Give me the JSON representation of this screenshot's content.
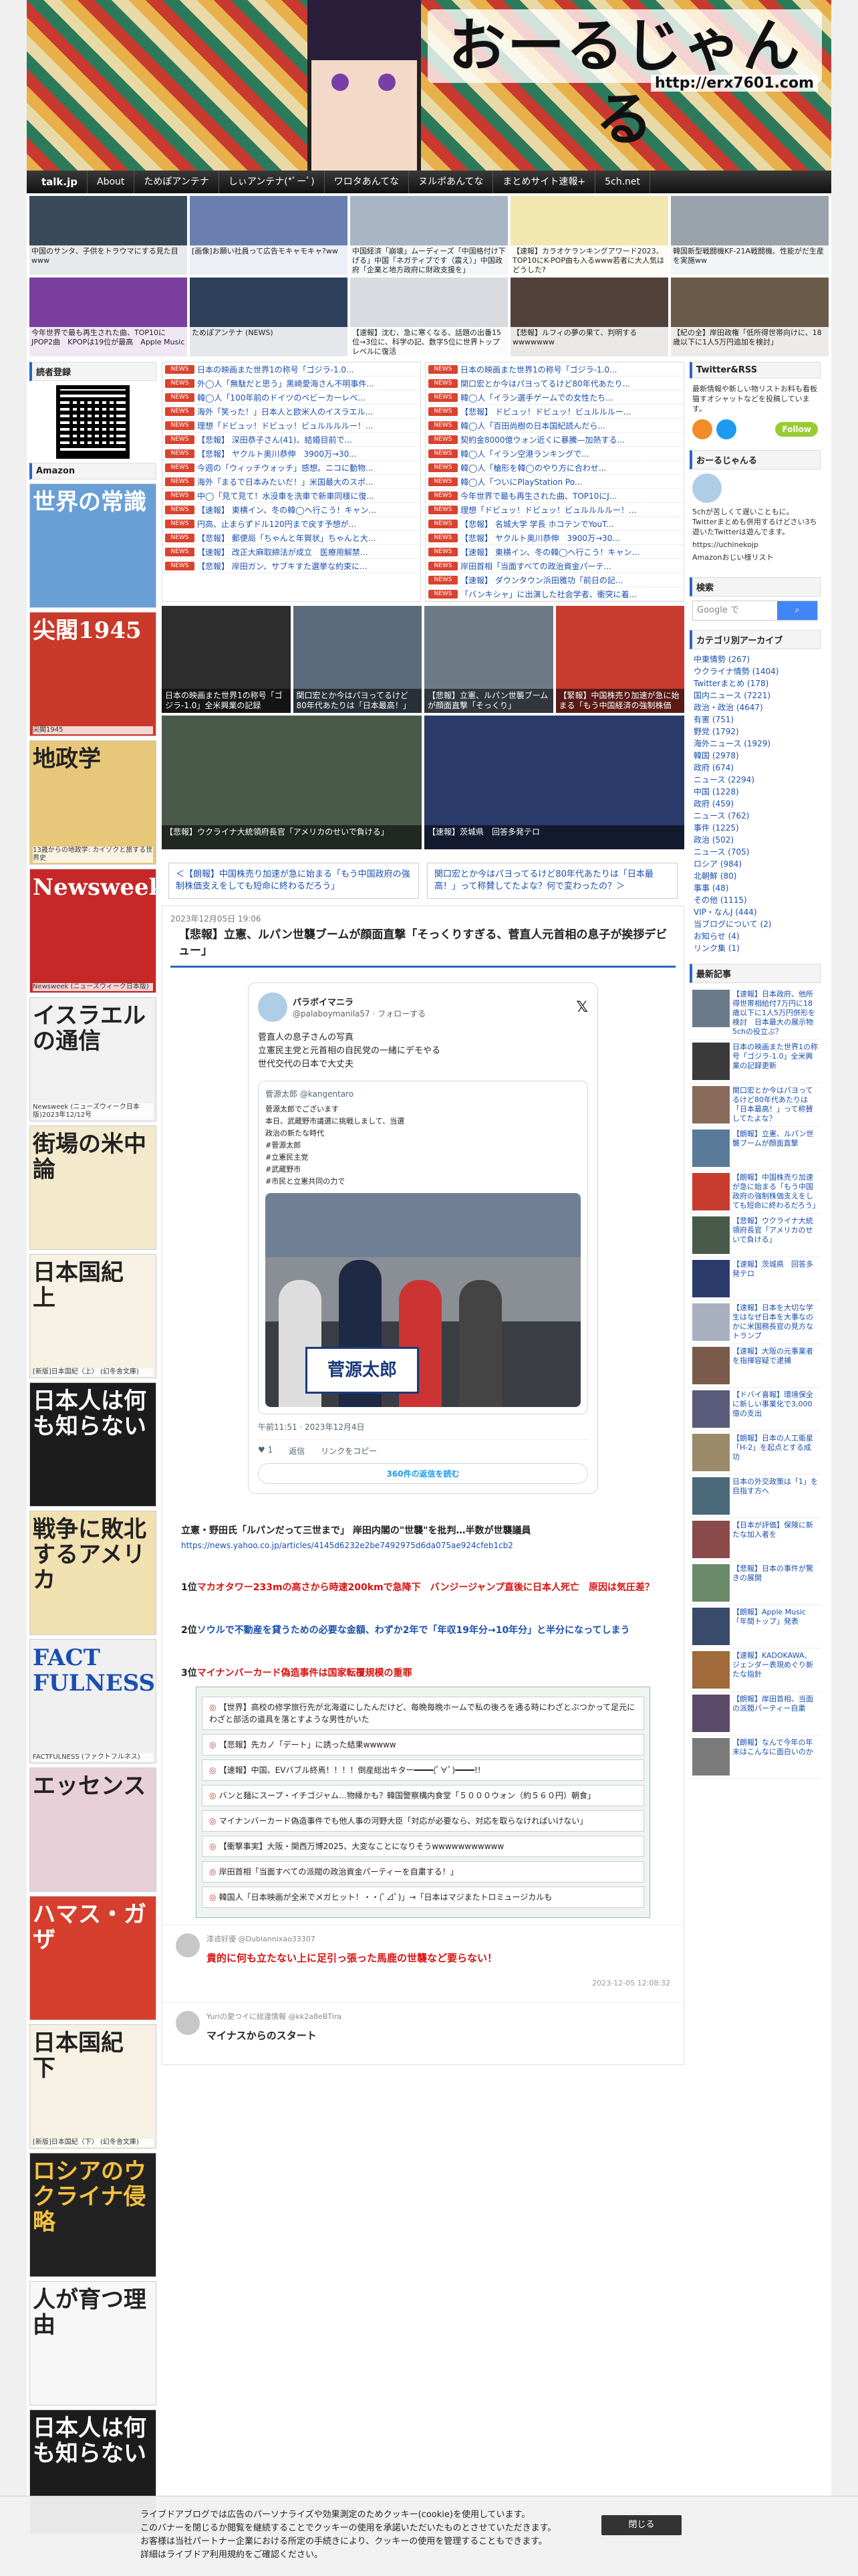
{
  "site": {
    "title": "おーるじゃんる",
    "url": "http://erx7601.com"
  },
  "nav": [
    "talk.jp",
    "About",
    "ためぽアンテナ",
    "しぃアンテナ(*ﾟーﾟ)",
    "ワロタあんてな",
    "ヌルポあんてな",
    "まとめサイト速報+",
    "5ch.net"
  ],
  "thumbs": [
    {
      "cap": "中国のサンタ、子供をトラウマにする見た目www",
      "color": "#3a4a5a"
    },
    {
      "cap": "[画像]お願い社員って広告モキャモキャ?ww",
      "color": "#6a7fb0"
    },
    {
      "cap": "中国経済「崩壊」ムーディーズ「中国格付け下げる」中国「ネガティブです（震え）」中国政府「企業と地方政府に財政支援を」",
      "color": "#a8b5c4"
    },
    {
      "cap": "【速報】カラオケランキングアワード2023、TOP10にK-POP曲も入るwww若者に大人気はどうした?",
      "color": "#f3e7b0"
    },
    {
      "cap": "韓国新型戦闘機KF-21A戦闘機、性能がだ生産を実施ww",
      "color": "#9aa2ab"
    },
    {
      "cap": "今年世界で最も再生された曲、TOP10にJPOP2曲　KPOPは19位が最高　Apple Music",
      "color": "#7a3f9f"
    },
    {
      "cap": "ためぽアンテナ (NEWS)",
      "color": "#2e3f5c"
    },
    {
      "cap": "【速報】沈む、急に寒くなる、話題の出番15位→3位に、科学の記、数字5位に世界トップレベルに復活",
      "color": "#d8dce0"
    },
    {
      "cap": "【悲報】ルフィの夢の果て、判明するwwwwwww",
      "color": "#52413a"
    },
    {
      "cap": "【紀の全】岸田政権「低所得世帯向けに、18歳以下に1人5万円追加を検討」",
      "color": "#6a5a4a"
    }
  ],
  "left": {
    "reader_head": "読者登録",
    "qr_note": "",
    "amazon_head": "Amazon",
    "books": [
      {
        "t": "世界の常識",
        "c": "",
        "bg": "#6a9fd6",
        "fg": "#fff"
      },
      {
        "t": "尖閣1945",
        "c": "尖閣1945",
        "bg": "#c93a2a",
        "fg": "#fff"
      },
      {
        "t": "地政学",
        "c": "13歳からの地政学: カイゾクと旅する世界史",
        "bg": "#e7c77a",
        "fg": "#222"
      },
      {
        "t": "Newsweek",
        "c": "Newsweek (ニューズウィーク日本版)",
        "bg": "#c62828",
        "fg": "#fff"
      },
      {
        "t": "イスラエルの通信",
        "c": "Newsweek (ニューズウィーク日本版)2023年12/12号",
        "bg": "#f1f1f1",
        "fg": "#222"
      },
      {
        "t": "街場の米中論",
        "c": "",
        "bg": "#f3e9cc",
        "fg": "#222"
      },
      {
        "t": "日本国紀 上",
        "c": "[新版]日本国紀〈上〉 (幻冬舎文庫)",
        "bg": "#f7f1e4",
        "fg": "#222"
      },
      {
        "t": "日本人は何も知らない",
        "c": "",
        "bg": "#1c1c1c",
        "fg": "#fff"
      },
      {
        "t": "戦争に敗北するアメリカ",
        "c": "",
        "bg": "#f1e0b0",
        "fg": "#222"
      },
      {
        "t": "FACT FULNESS",
        "c": "FACTFULNESS (ファクトフルネス)",
        "bg": "#f0f0f0",
        "fg": "#1a4fb0"
      },
      {
        "t": "エッセンス",
        "c": "",
        "bg": "#e8d0d8",
        "fg": "#222"
      },
      {
        "t": "ハマス・ガザ",
        "c": "",
        "bg": "#d63f2d",
        "fg": "#fff"
      },
      {
        "t": "日本国紀 下",
        "c": "[新版]日本国紀〈下〉 (幻冬舎文庫)",
        "bg": "#f7f1e4",
        "fg": "#222"
      },
      {
        "t": "ロシアのウクライナ侵略",
        "c": "",
        "bg": "#222",
        "fg": "#f5c140"
      },
      {
        "t": "人が育つ理由",
        "c": "",
        "bg": "#f7f7f7",
        "fg": "#222"
      },
      {
        "t": "日本人は何も知らない",
        "c": "",
        "bg": "#1c1c1c",
        "fg": "#fff"
      }
    ]
  },
  "lists": {
    "left": [
      "日本の映画また世界1の称号「ゴジラ-1.0...",
      "外◯人「無駄だと思う」黒崎愛海さん不明事件...",
      "韓◯人「100年前のドイツのベビーカーレベ...",
      "海外「笑った！」日本人と欧米人のイスラエル...",
      "理想「ドビュッ！ドビュッ！ビュルルルルー！...",
      "【悲報】 深田恭子さん(41)、結婚目前で...",
      "【悲報】 ヤクルト奥川恭伸　3900万→30...",
      "今週の「ウィッチウォッチ」感想。ニコに動物...",
      "海外「まるで日本みたいだ！」米国最大のスポ...",
      "中◯「見て見て！水没車を洗車で新車同様に復...",
      "【速報】 東横イン、冬の韓◯へ行こう！キャン...",
      "円高、止まらずドル120円まで戻す予想が...",
      "【悲報】 郵便局「ちゃんと年賀状」ちゃんと大...",
      "【速報】 改正大麻取締法が成立　医療用解禁...",
      "【悲報】 岸田ガン、サブキすた選挙な約束に..."
    ],
    "right": [
      "日本の映画また世界1の称号「ゴジラ-1.0...",
      "関口宏とか今はパヨってるけど80年代あたり...",
      "韓◯人「イラン選手ゲームでの女性たち...",
      "【悲報】 ドビュッ！ドビュッ！ビュルルルー...",
      "韓◯人「百田尚樹の日本国紀読んだら...",
      "契約金8000億ウォン近くに暴騰—加熱する...",
      "韓◯人「イラン空港ランキングで...",
      "韓◯人「槍形を韓◯のやり方に合わせ...",
      "韓◯人「ついにPlayStation Po...",
      "今年世界で最も再生された曲、TOP10にJ...",
      "理想「ドビュッ！ドビュッ！ビュルルルルー！...",
      "【悲報】 名城大学 学長 ホコテンでYouT...",
      "【悲報】 ヤクルト奥川恭伸　3900万→30...",
      "【速報】 東横イン、冬の韓◯へ行こう！キャン...",
      "岸田首相「当面すべての政治資金パーテ...",
      "【速報】 ダウンタウン浜田雅功「前日の記...",
      "「バンキシャ」に出演した社会学者、衝突に着..."
    ],
    "badge": "NEWS"
  },
  "featured": [
    {
      "cap": "日本の映画また世界1の称号「ゴジラ-1.0」全米興業の記録",
      "bg": "#2d2d2d"
    },
    {
      "cap": "関口宏とか今はパヨってるけど80年代あたりは「日本最高！」",
      "bg": "#5a6a7a"
    },
    {
      "cap": "【悲報】立憲、ルパン世襲ブームが顔面直撃「そっくり」",
      "bg": "#6e7b86"
    },
    {
      "cap": "【緊報】中国株売り加速が急に始まる「もう中国経済の強制株価",
      "bg": "#c83b2e"
    }
  ],
  "featured2": [
    {
      "cap": "【悲報】ウクライナ大統領府長官「アメリカのせいで負ける」",
      "bg": "#4a5a4a"
    },
    {
      "cap": "【速報】茨城県　回答多発テロ",
      "bg": "#2a3a6a"
    }
  ],
  "prevnext": {
    "prev": "＜【朗報】中国株売り加速が急に始まる「もう中国政府の強制株価支えをしても短命に終わるだろう」",
    "next": "関口宏とか今はパヨってるけど80年代あたりは「日本最高！」って称賛してたよな？何で変わったの？＞"
  },
  "article": {
    "date": "2023年12月05日 19:06",
    "title": "【悲報】立憲、ルパン世襲ブームが顔面直撃「そっくりすぎる、菅直人元首相の息子が挨拶デビュー」",
    "tweet": {
      "name": "パラボイマニラ",
      "handle": "@palaboymanila57 · フォローする",
      "body1": "菅直人の息子さんの写真",
      "body2": "立憲民主党と元首相の自民党の一緒にデモやる",
      "body3": "世代交代の日本で大丈夫",
      "quote_head": "菅源太郎 @kangentaro",
      "quote_lines": [
        "菅源太郎でございます",
        "本日、武蔵野市議選に挑戦しまして、当選",
        "政治の新たな時代",
        "#菅源太郎",
        "#立憲民主党",
        "#武蔵野市",
        "#市民と立憲共同の力で"
      ],
      "sign": "菅源太郎",
      "time": "午前11:51 · 2023年12月4日",
      "likes": "1",
      "reply": "返信",
      "copy": "リンクをコピー",
      "replies_btn": "360件の返信を読む"
    },
    "news_title": "立憲・野田氏「ルパンだって三世まで」 岸田内閣の\"世襲\"を批判…半数が世襲議員",
    "news_url": "https://news.yahoo.co.jp/articles/4145d6232e2be7492975d6da075ae924cfeb1cb2",
    "rank1": "1位",
    "rank1_text": "マカオタワー233mの高さから時速200kmで急降下　バンジージャンプ直後に日本人死亡　原因は気圧差？",
    "rank2": "2位",
    "rank2_text": "ソウルで不動産を貸うための必要な金額、わずか2年で「年収19年分→10年分」と半分になってしまう",
    "rank3": "3位",
    "rank3_text": "マイナンバーカード偽造事件は国家転覆規模の重罪",
    "greenbox": [
      "【世界】高校の修学旅行先が北海道にしたんだけど、毎晩毎晩ホームで私の後ろを通る時にわざとぶつかって足元にわざと部活の道具を落とすような男性がいた",
      "【悲報】先カノ「デート」に誘った結果wwwww",
      "【速報】中国、EVバブル終焉！！！！倒産総出キター━━━━(ﾟ∀ﾟ)━━━━!!",
      "バンと麺にスープ・イチゴジャム…物縁かも？韓国警察構内食堂「５０００ウォン（約５６０円）朝食」",
      "マイナンバーカード偽造事件でも他人事の河野大臣「対応が必要なら、対応を取らなければいけない」",
      "【衝撃事実】大阪・関西万博2025、大変なことになりそうwwwwwwwwwww",
      "岸田首相「当面すべての派閥の政治資金パーティーを自粛する！」",
      "韓国人「日本映画が全米でメガヒット！・・(ﾟ⊿ﾟ)」→「日本はマジまたトロミュージカルも"
    ],
    "comments": [
      {
        "name": "漆迹好優 @Dubiannixao33307",
        "text": "貴的に何も立たない上に足引っ張った馬鹿の世襲など要らない！",
        "time": "2023-12-05 12:08:32"
      },
      {
        "name": "Yuriの愛つイに総違情報 @kk2a8eBTira",
        "text": "マイナスからのスタート",
        "time": ""
      }
    ]
  },
  "right": {
    "twitter_head": "Twitter&RSS",
    "twitter_txt": "最新情報や新しい物リストお料も看板猫すオシャットなどを投稿しています。",
    "follow": "Follow",
    "site_head": "おーるじゃんる",
    "site_txt": "5chが苦しくて遅いこともに。Twitterまとめも併用するけどさい3ち遊いたTwitterは遊んでます。",
    "site_url": "https://uchinekojp",
    "site_url2": "Amazonおじい様リスト",
    "search_head": "検索",
    "search_placeholder": "Google で",
    "search_btn": "検索",
    "cat_head": "カテゴリ別アーカイブ",
    "categories": [
      "中東情勢 (267)",
      "ウクライナ情勢 (1404)",
      "Twitterまとめ (178)",
      "国内ニュース (7221)",
      "政治・政治 (4647)",
      "有害 (751)",
      "野党 (1792)",
      "海外ニュース (1929)",
      "韓国 (2978)",
      "政府 (674)",
      "ニュース (2294)",
      "中国 (1228)",
      "政府 (459)",
      "ニュース (762)",
      "事件 (1225)",
      "政治 (502)",
      "ニュース (705)",
      "ロシア (984)",
      "北朝鮮 (80)",
      "事事 (48)",
      "その他 (1115)",
      "VIP・なんJ (444)",
      "当ブログについて (2)",
      "お知らせ (4)",
      "リンク集 (1)"
    ],
    "recent_head": "最新記事",
    "recent": [
      "【速報】日本政府、他所得世帯相給付7万円に18歳以下に1人5万円併形を検討　日本最大の展示物5chの役立ぶ？",
      "日本の映画また世界1の称号「ゴジラ-1.0」全米興業の記録更新",
      "関口宏とか今はパヨってるけど80年代あたりは「日本最高！」って称賛してたよな？",
      "【朗報】立憲、ルパン世襲ブームが顔面直撃",
      "【朗報】中国株売り加速が急に始まる「もう中国政府の強制株価支えをしても短命に終わるだろう」",
      "【悲報】ウクライナ大統領府長官「アメリカのせいで負ける」",
      "【速報】茨城県　回答多発テロ",
      "【速報】日本を大切な学生はなぜ日本を大事なのかに米国務長官の見方なトランプ",
      "【速報】大阪の元事業者を指揮容疑で逮捕",
      "【ドバイ喜報】環境保全に新しい事業化で3,000億の支出",
      "【朗報】日本の人工衛星「H-2」を起点とする成功",
      "日本の外交政策は「1」を目指す方へ",
      "【日本が評価】保険に新たな加入者を",
      "【悲報】日本の事件が驚きの展開",
      "【朗報】Apple Music「年間トップ」発表",
      "【速報】KADOKAWA、ジェンダー表現めぐり新たな指針",
      "【朗報】岸田首相、当面の派閥パーティー自粛",
      "【朗報】なんで今年の年末はこんなに面白いのか"
    ]
  },
  "cookie": {
    "line1": "ライブドアブログでは広告のパーソナライズや効果測定のためクッキー(cookie)を使用しています。",
    "line2": "このバナーを閉じるか閲覧を継続することでクッキーの使用を承諾いただいたものとさせていただきます。",
    "line3": "お客様は当社パートナー企業における所定の手続きにより、クッキーの使用を管理することもできます。",
    "line4": "詳細はライブドア利用規約をご確認ください。",
    "close": "閉じる"
  },
  "colors": {
    "accent": "#2b66c7",
    "red": "#d9120f",
    "badge": "#d9432f"
  }
}
